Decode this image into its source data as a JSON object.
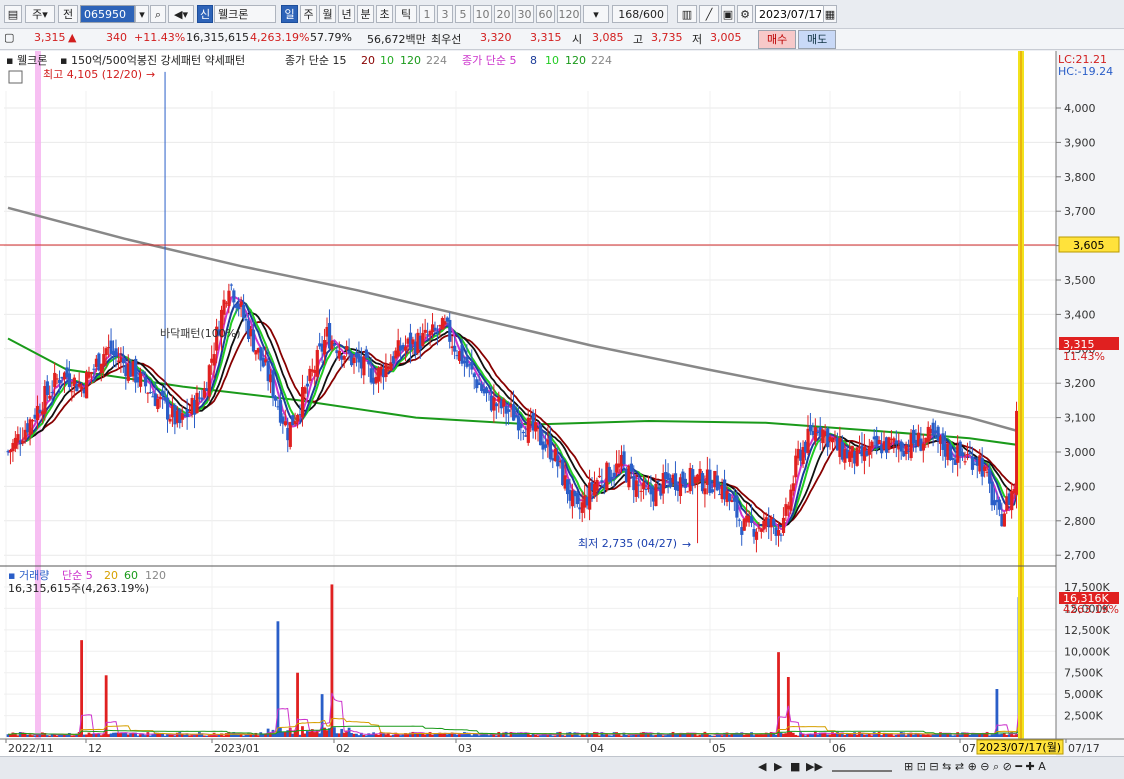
{
  "toolbar": {
    "period_main": "주",
    "jeon": "전",
    "code": "065950",
    "badge": "신",
    "stock_name": "웰크론",
    "period_tabs": [
      "일",
      "주",
      "월",
      "년",
      "분",
      "초",
      "틱"
    ],
    "minute_tabs": [
      "1",
      "3",
      "5",
      "10",
      "20",
      "30",
      "60",
      "120"
    ],
    "count": "168",
    "total": "/600",
    "date": "2023/07/17"
  },
  "quote": {
    "price": "3,315",
    "price_arrow": "▲",
    "change": "340",
    "change_pct": "+11.43%",
    "volume": "16,315,615",
    "volume_pct": "4,263.19%",
    "turnover": "57.79%",
    "amount": "56,672백만",
    "best_ask_label": "최우선",
    "best_ask": "3,320",
    "best_bid": "3,315",
    "open_label": "시",
    "open": "3,085",
    "high_label": "고",
    "high": "3,735",
    "low_label": "저",
    "low": "3,005",
    "buy_label": "매수",
    "sell_label": "매도"
  },
  "legend": {
    "name": "웰크론",
    "pattern": "150억/500억봉진  강세패턴  약세패턴",
    "ma1_label": "종가 단순 15",
    "ma1_periods": [
      "20",
      "10",
      "120",
      "224"
    ],
    "ma2_label": "종가 단순 5",
    "ma2_periods": [
      "8",
      "10",
      "120",
      "224"
    ],
    "lc": "LC:21.21",
    "hc": "HC:-19.24",
    "high_note": "최고 4,105 (12/20)",
    "low_note": "최저 2,735 (04/27)",
    "pattern_note": "바닥패턴(100%)",
    "hline_value": "3,605",
    "last_price": "3,315",
    "last_pct": "11.43%",
    "vol_title": "거래량",
    "vol_ma_label": "단순 5",
    "vol_ma_periods": [
      "20",
      "60",
      "120"
    ],
    "vol_value": "16,315,615주(4,263.19%)",
    "vol_last": "16,316K",
    "vol_last_pct": "4263.19%",
    "cursor_date": "2023/07/17(월)"
  },
  "colors": {
    "up": "#e02020",
    "down": "#2a5ec8",
    "ma5": "#cc33cc",
    "ma8": "#1c3c99",
    "ma10": "#22cc22",
    "ma15": "#111111",
    "ma20": "#880000",
    "ma120": "#1a9a1a",
    "ma224": "#888888"
  },
  "chart_data": {
    "type": "candlestick",
    "ylim": [
      2650,
      4180
    ],
    "y_ticks": [
      "4,000",
      "3,900",
      "3,800",
      "3,700",
      "3,600",
      "3,500",
      "3,400",
      "3,300",
      "3,200",
      "3,100",
      "3,000",
      "2,900",
      "2,800",
      "2,700"
    ],
    "x_labels": [
      "2022/11",
      "12",
      "2023/01",
      "02",
      "03",
      "04",
      "05",
      "06",
      "07",
      "07/17"
    ],
    "vol_ylim": [
      0,
      18500
    ],
    "vol_ticks": [
      "17,500K",
      "15,000K",
      "12,500K",
      "10,000K",
      "7,500K",
      "5,000K",
      "2,500K"
    ],
    "highest": {
      "value": 4105,
      "date": "12/20"
    },
    "lowest": {
      "value": 2735,
      "date": "04/27"
    },
    "hline": 3605,
    "last_ohlc": {
      "open": 3085,
      "high": 3735,
      "low": 3005,
      "close": 3315
    },
    "ma120_approx": [
      [
        0,
        3330
      ],
      [
        20,
        3240
      ],
      [
        60,
        3190
      ],
      [
        100,
        3150
      ],
      [
        140,
        3100
      ],
      [
        180,
        3080
      ],
      [
        220,
        3090
      ],
      [
        260,
        3085
      ],
      [
        300,
        3060
      ],
      [
        330,
        3040
      ],
      [
        347,
        3020
      ]
    ],
    "ma224_approx": [
      [
        0,
        3710
      ],
      [
        40,
        3620
      ],
      [
        80,
        3540
      ],
      [
        120,
        3470
      ],
      [
        160,
        3390
      ],
      [
        200,
        3310
      ],
      [
        240,
        3240
      ],
      [
        270,
        3190
      ],
      [
        300,
        3150
      ],
      [
        330,
        3100
      ],
      [
        347,
        3060
      ]
    ]
  }
}
